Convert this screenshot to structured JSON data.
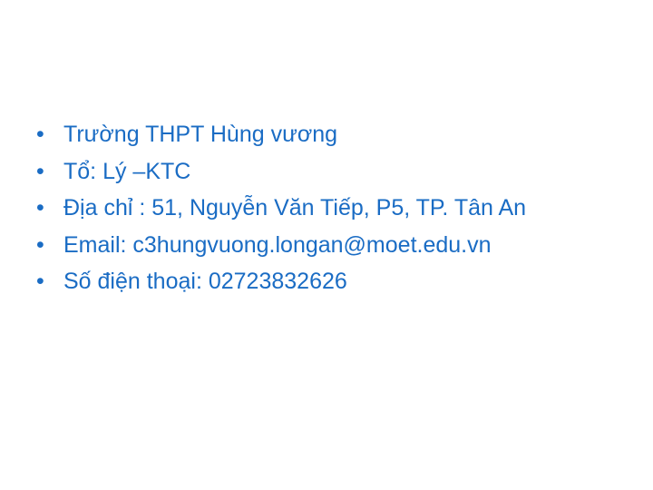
{
  "slide": {
    "items": [
      {
        "bullet": "•",
        "text": "Trường THPT Hùng vương"
      },
      {
        "bullet": "•",
        "text": "Tổ: Lý –KTC"
      },
      {
        "bullet": "•",
        "text": "Địa chỉ : 51, Nguyễn Văn Tiếp, P5, TP. Tân An"
      },
      {
        "bullet": "•",
        "text": "Email: c3hungvuong.longan@moet.edu.vn"
      },
      {
        "bullet": "•",
        "text": "Số điện thoại: 02723832626"
      }
    ]
  },
  "colors": {
    "text": "#1a6cc4",
    "background": "#ffffff"
  }
}
